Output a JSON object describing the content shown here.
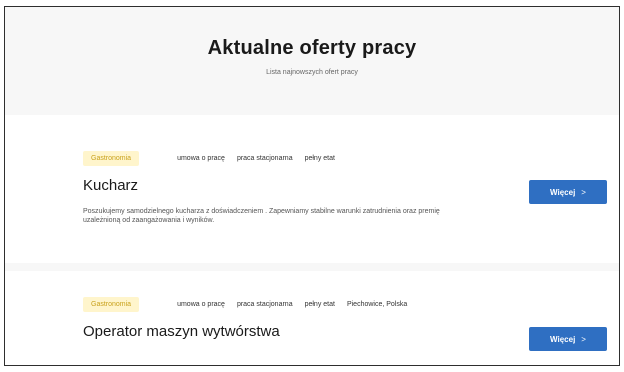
{
  "header": {
    "title": "Aktualne oferty pracy",
    "subtitle": "Lista najnowszych ofert pracy"
  },
  "offers": [
    {
      "badge": "Gastronomia",
      "tags": [
        "umowa o pracę",
        "praca stacjonarna",
        "pełny etat"
      ],
      "title": "Kucharz",
      "description": "Poszukujemy samodzielnego kucharza z doświadczeniem . Zapewniamy stabilne warunki zatrudnienia oraz premię uzależnioną od zaangażowania i wyników.",
      "button_label": "Więcej",
      "button_icon": "chevron-right-icon"
    },
    {
      "badge": "Gastronomia",
      "tags": [
        "umowa o pracę",
        "praca stacjonarna",
        "pełny etat",
        "Piechowice, Polska"
      ],
      "title": "Operator maszyn wytwórstwa",
      "button_label": "Więcej",
      "button_icon": "chevron-right-icon"
    }
  ],
  "colors": {
    "badge_bg": "#fff5cc",
    "badge_text": "#c9a21d",
    "button_bg": "#2f6fc2"
  }
}
